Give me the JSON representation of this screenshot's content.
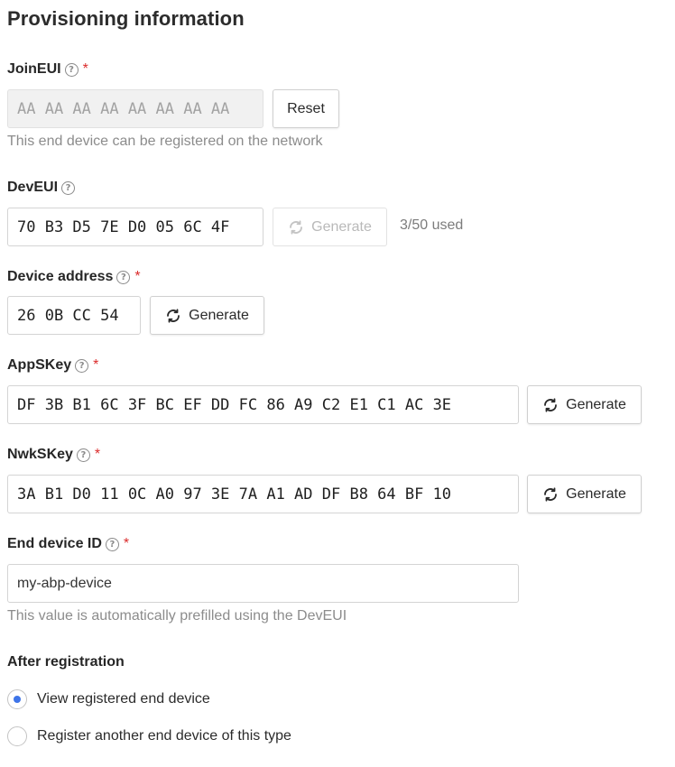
{
  "section_title": "Provisioning information",
  "join_eui": {
    "label": "JoinEUI",
    "required": "*",
    "value": "AA AA AA AA AA AA AA AA",
    "reset_label": "Reset",
    "hint": "This end device can be registered on the network"
  },
  "dev_eui": {
    "label": "DevEUI",
    "value": "70 B3 D5 7E D0 05 6C 4F",
    "generate_label": "Generate",
    "usage": "3/50 used"
  },
  "device_address": {
    "label": "Device address",
    "required": "*",
    "value": "26 0B CC 54",
    "generate_label": "Generate"
  },
  "app_skey": {
    "label": "AppSKey",
    "required": "*",
    "value": "DF 3B B1 6C 3F BC EF DD FC 86 A9 C2 E1 C1 AC 3E",
    "generate_label": "Generate"
  },
  "nwk_skey": {
    "label": "NwkSKey",
    "required": "*",
    "value": "3A B1 D0 11 0C A0 97 3E 7A A1 AD DF B8 64 BF 10",
    "generate_label": "Generate"
  },
  "end_device_id": {
    "label": "End device ID",
    "required": "*",
    "value": "my-abp-device",
    "hint": "This value is automatically prefilled using the DevEUI"
  },
  "after_registration": {
    "label": "After registration",
    "options": [
      {
        "label": "View registered end device",
        "selected": true
      },
      {
        "label": "Register another end device of this type",
        "selected": false
      }
    ]
  },
  "icons": {
    "help": "help-circle-icon",
    "generate": "refresh-icon"
  },
  "colors": {
    "required": "#db2c2c",
    "radio_selected": "#3e74e8",
    "hint_text": "#8c8c8c"
  }
}
